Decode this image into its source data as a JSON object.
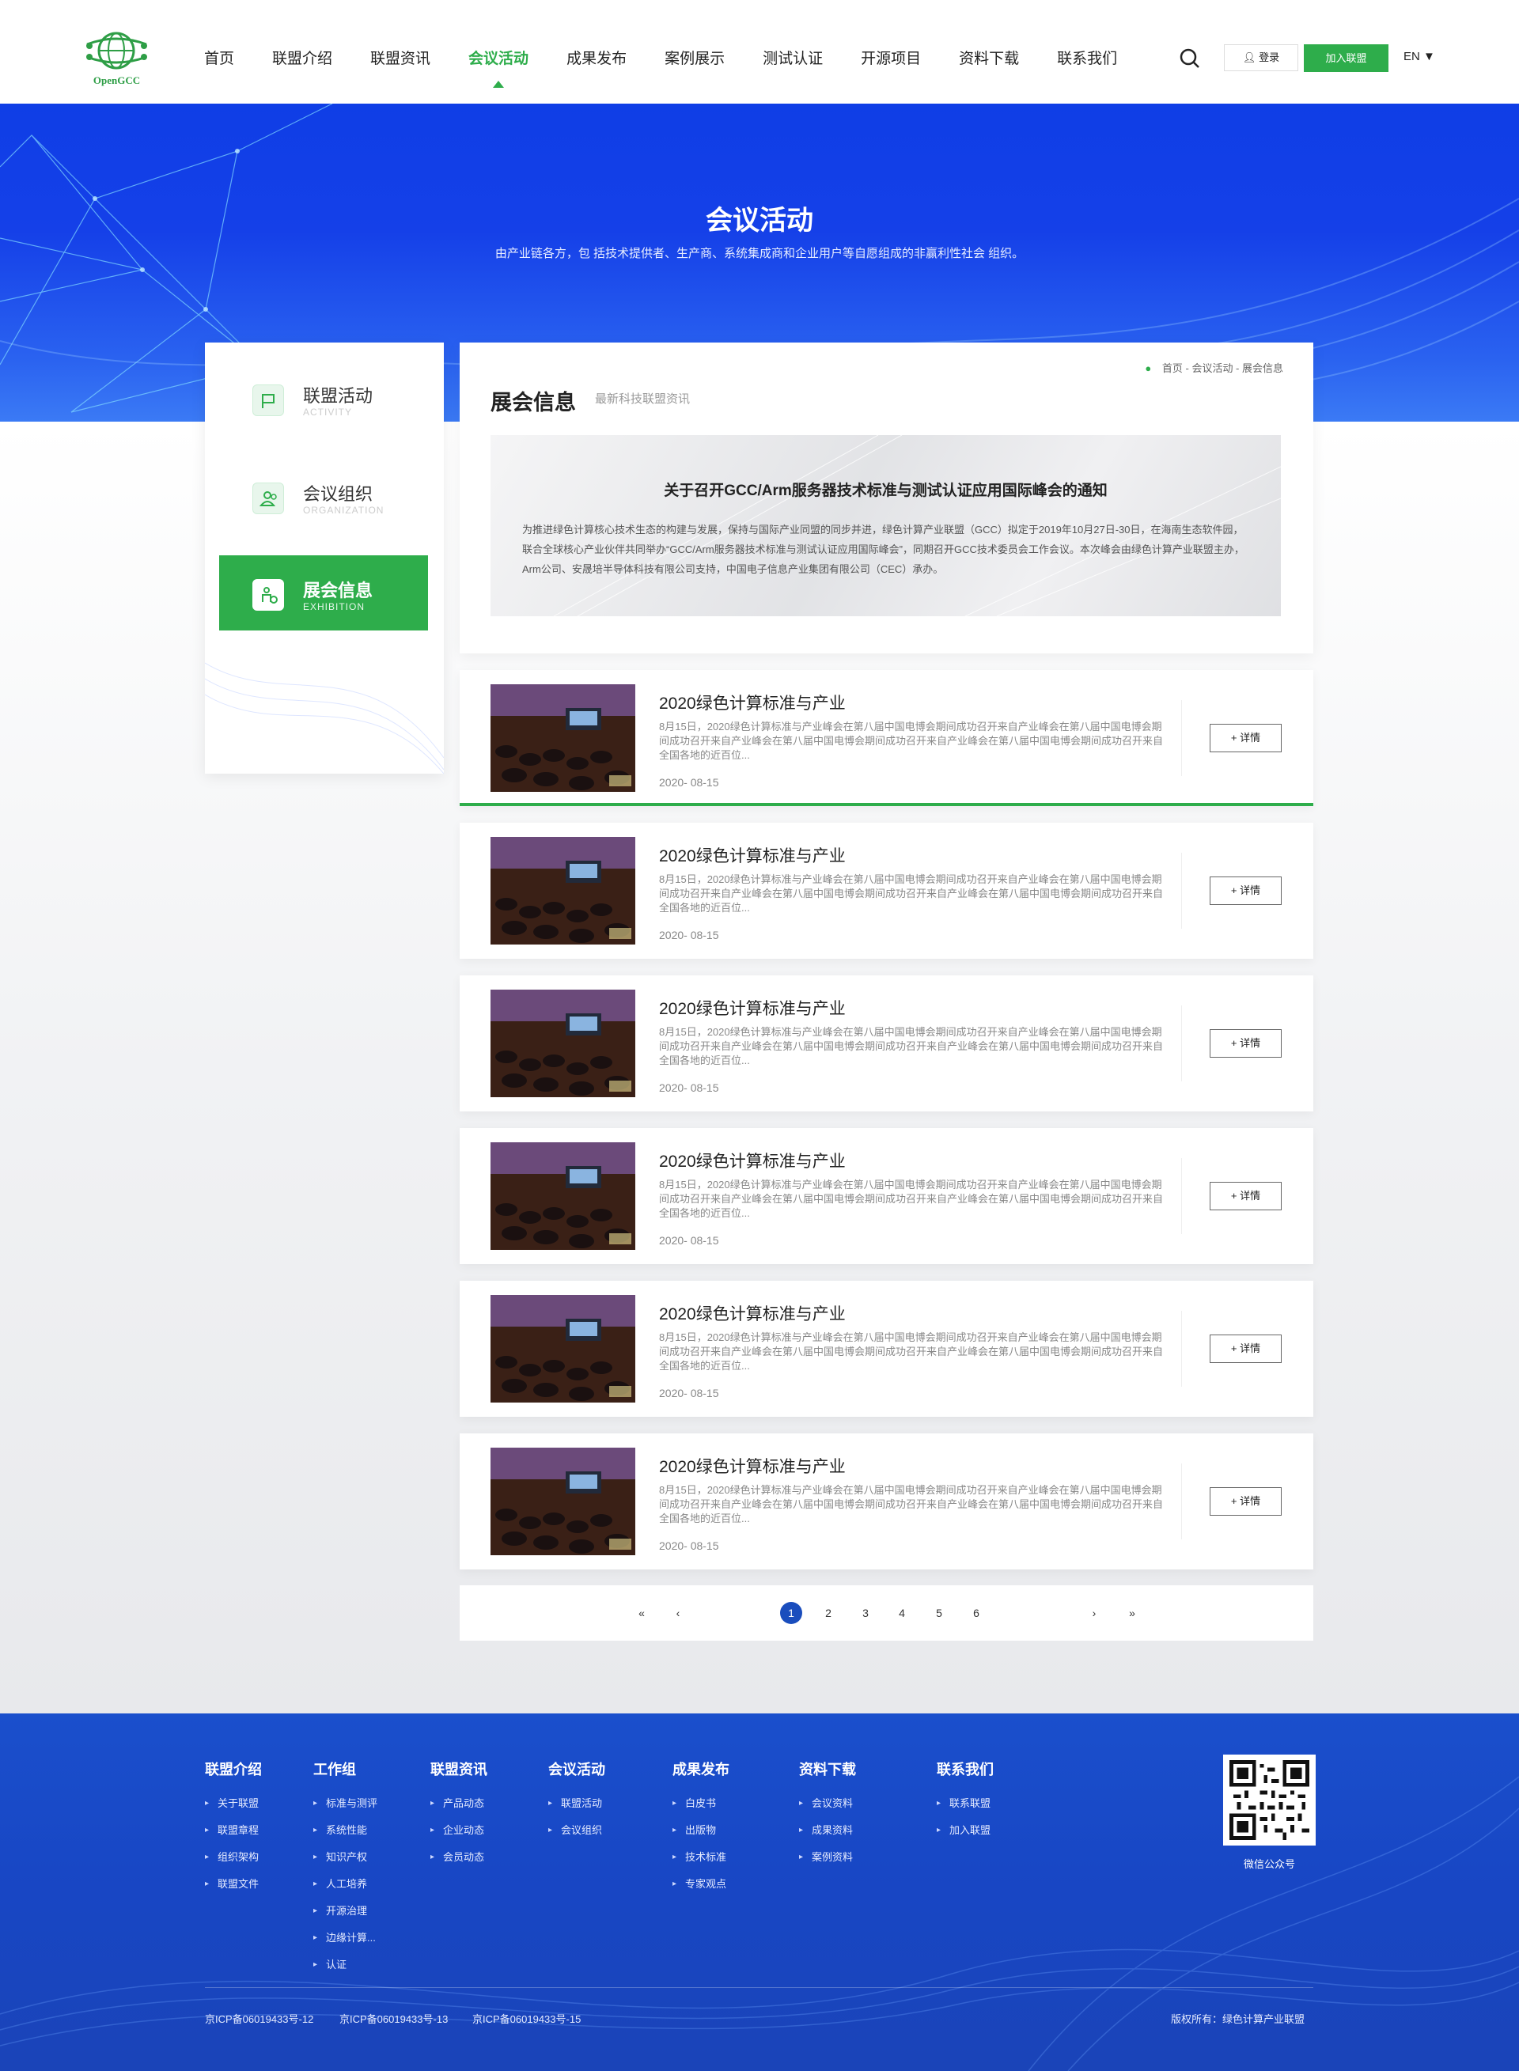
{
  "header": {
    "logo_text": "OpenGCC",
    "nav": [
      {
        "label": "首页",
        "active": false
      },
      {
        "label": "联盟介绍",
        "active": false
      },
      {
        "label": "联盟资讯",
        "active": false
      },
      {
        "label": "会议活动",
        "active": true
      },
      {
        "label": "成果发布",
        "active": false
      },
      {
        "label": "案例展示",
        "active": false
      },
      {
        "label": "测试认证",
        "active": false
      },
      {
        "label": "开源项目",
        "active": false
      },
      {
        "label": "资料下载",
        "active": false
      },
      {
        "label": "联系我们",
        "active": false
      }
    ],
    "login_label": "登录",
    "join_label": "加入联盟",
    "lang_label": "EN"
  },
  "banner": {
    "title": "会议活动",
    "subtitle": "由产业链各方，包 括技术提供者、生产商、系统集成商和企业用户等自愿组成的非赢利性社会 组织。"
  },
  "sidebar": {
    "items": [
      {
        "label": "联盟活动",
        "en": "ACTIVITY",
        "active": false
      },
      {
        "label": "会议组织",
        "en": "ORGANIZATION",
        "active": false
      },
      {
        "label": "展会信息",
        "en": "EXHIBITION",
        "active": true
      }
    ]
  },
  "main": {
    "breadcrumb": "首页 - 会议活动 - 展会信息",
    "title": "展会信息",
    "subtitle": "最新科技联盟资讯",
    "notice": {
      "title": "关于召开GCC/Arm服务器技术标准与测试认证应用国际峰会的通知",
      "body": "为推进绿色计算核心技术生态的构建与发展，保持与国际产业同盟的同步并进，绿色计算产业联盟（GCC）拟定于2019年10月27日-30日，在海南生态软件园，联合全球核心产业伙伴共同举办“GCC/Arm服务器技术标准与测试认证应用国际峰会”，同期召开GCC技术委员会工作会议。本次峰会由绿色计算产业联盟主办，Arm公司、安晟培半导体科技有限公司支持，中国电子信息产业集团有限公司（CEC）承办。"
    }
  },
  "list": {
    "items": [
      {
        "title": "2020绿色计算标准与产业",
        "desc": "8月15日，2020绿色计算标准与产业峰会在第八届中国电博会期间成功召开来自产业峰会在第八届中国电博会期间成功召开来自产业峰会在第八届中国电博会期间成功召开来自产业峰会在第八届中国电博会期间成功召开来自全国各地的近百位...",
        "date": "2020- 08-15",
        "button": "+ 详情"
      },
      {
        "title": "2020绿色计算标准与产业",
        "desc": "8月15日，2020绿色计算标准与产业峰会在第八届中国电博会期间成功召开来自产业峰会在第八届中国电博会期间成功召开来自产业峰会在第八届中国电博会期间成功召开来自产业峰会在第八届中国电博会期间成功召开来自全国各地的近百位...",
        "date": "2020- 08-15",
        "button": "+ 详情"
      },
      {
        "title": "2020绿色计算标准与产业",
        "desc": "8月15日，2020绿色计算标准与产业峰会在第八届中国电博会期间成功召开来自产业峰会在第八届中国电博会期间成功召开来自产业峰会在第八届中国电博会期间成功召开来自产业峰会在第八届中国电博会期间成功召开来自全国各地的近百位...",
        "date": "2020- 08-15",
        "button": "+ 详情"
      },
      {
        "title": "2020绿色计算标准与产业",
        "desc": "8月15日，2020绿色计算标准与产业峰会在第八届中国电博会期间成功召开来自产业峰会在第八届中国电博会期间成功召开来自产业峰会在第八届中国电博会期间成功召开来自产业峰会在第八届中国电博会期间成功召开来自全国各地的近百位...",
        "date": "2020- 08-15",
        "button": "+ 详情"
      },
      {
        "title": "2020绿色计算标准与产业",
        "desc": "8月15日，2020绿色计算标准与产业峰会在第八届中国电博会期间成功召开来自产业峰会在第八届中国电博会期间成功召开来自产业峰会在第八届中国电博会期间成功召开来自产业峰会在第八届中国电博会期间成功召开来自全国各地的近百位...",
        "date": "2020- 08-15",
        "button": "+ 详情"
      },
      {
        "title": "2020绿色计算标准与产业",
        "desc": "8月15日，2020绿色计算标准与产业峰会在第八届中国电博会期间成功召开来自产业峰会在第八届中国电博会期间成功召开来自产业峰会在第八届中国电博会期间成功召开来自产业峰会在第八届中国电博会期间成功召开来自全国各地的近百位...",
        "date": "2020- 08-15",
        "button": "+ 详情"
      }
    ]
  },
  "pagination": {
    "first": "«",
    "prev": "‹",
    "pages": [
      "1",
      "2",
      "3",
      "4",
      "5",
      "6"
    ],
    "current": "1",
    "next": "›",
    "last": "»"
  },
  "footer": {
    "columns": [
      {
        "title": "联盟介绍",
        "links": [
          "关于联盟",
          "联盟章程",
          "组织架构",
          "联盟文件"
        ]
      },
      {
        "title": "工作组",
        "links": [
          "标准与测评",
          "系统性能",
          "知识产权",
          "人工培养",
          "开源治理",
          "边缘计算...",
          "认证"
        ]
      },
      {
        "title": "联盟资讯",
        "links": [
          "产品动态",
          "企业动态",
          "会员动态"
        ]
      },
      {
        "title": "会议活动",
        "links": [
          "联盟活动",
          "会议组织"
        ]
      },
      {
        "title": "成果发布",
        "links": [
          "白皮书",
          "出版物",
          "技术标准",
          "专家观点"
        ]
      },
      {
        "title": "资料下载",
        "links": [
          "会议资料",
          "成果资料",
          "案例资料"
        ]
      },
      {
        "title": "联系我们",
        "links": [
          "联系联盟",
          "加入联盟"
        ]
      }
    ],
    "qr_label": "微信公众号",
    "icp": [
      "京ICP备06019433号-12",
      "京ICP备06019433号-13",
      "京ICP备06019433号-15"
    ],
    "copyright": "版权所有：绿色计算产业联盟"
  },
  "colors": {
    "brand_green": "#2ead4b",
    "banner_blue": "#1540e8",
    "footer_blue": "#1a4fcc",
    "pager_blue": "#1a4dbd"
  }
}
